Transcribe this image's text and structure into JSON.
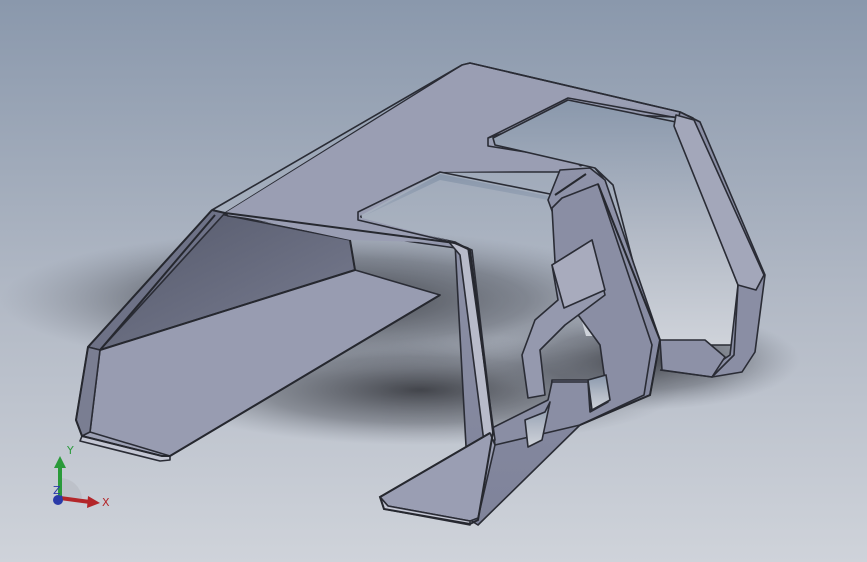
{
  "viewport": {
    "background_top": "#8e9cb0",
    "background_bottom": "#c9ced6"
  },
  "part": {
    "face_color": "#9498ad",
    "face_dark": "#6e7287",
    "face_light": "#a9adc0",
    "edge_color": "#2a2c35",
    "fillet_color": "#c3c6d3"
  },
  "triad": {
    "x_label": "X",
    "y_label": "Y",
    "z_label": "Z",
    "x_color": "#b3262a",
    "y_color": "#2a9a3a",
    "z_color": "#2a3aa8"
  }
}
